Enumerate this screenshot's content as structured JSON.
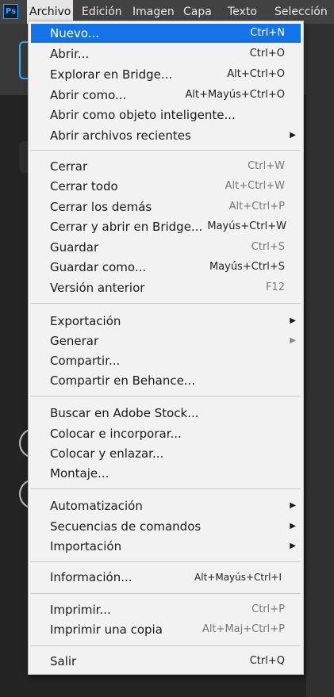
{
  "app": {
    "logo_text": "Ps"
  },
  "menubar": {
    "items": [
      "Archivo",
      "Edición",
      "Imagen",
      "Capa",
      "Texto",
      "Selección"
    ]
  },
  "file_menu": {
    "items": [
      {
        "label": "Nuevo...",
        "shortcut": "Ctrl+N",
        "highlighted": true
      },
      {
        "label": "Abrir...",
        "shortcut": "Ctrl+O"
      },
      {
        "label": "Explorar en Bridge...",
        "shortcut": "Alt+Ctrl+O"
      },
      {
        "label": "Abrir como...",
        "shortcut": "Alt+Mayús+Ctrl+O"
      },
      {
        "label": "Abrir como objeto inteligente..."
      },
      {
        "label": "Abrir archivos recientes",
        "submenu": true
      },
      {
        "label": "Cerrar",
        "shortcut": "Ctrl+W"
      },
      {
        "label": "Cerrar todo",
        "shortcut": "Alt+Ctrl+W"
      },
      {
        "label": "Cerrar los demás",
        "shortcut": "Alt+Ctrl+P"
      },
      {
        "label": "Cerrar y abrir en Bridge...",
        "shortcut": "Mayús+Ctrl+W"
      },
      {
        "label": "Guardar",
        "shortcut": "Ctrl+S"
      },
      {
        "label": "Guardar como...",
        "shortcut": "Mayús+Ctrl+S"
      },
      {
        "label": "Versión anterior",
        "shortcut": "F12"
      },
      {
        "label": "Exportación",
        "submenu": true
      },
      {
        "label": "Generar",
        "submenu": true
      },
      {
        "label": "Compartir..."
      },
      {
        "label": "Compartir en Behance..."
      },
      {
        "label": "Buscar en Adobe Stock..."
      },
      {
        "label": "Colocar e incorporar..."
      },
      {
        "label": "Colocar y enlazar..."
      },
      {
        "label": "Montaje..."
      },
      {
        "label": "Automatización",
        "submenu": true
      },
      {
        "label": "Secuencias de comandos",
        "submenu": true
      },
      {
        "label": "Importación",
        "submenu": true
      },
      {
        "label": "Información...",
        "shortcut": "Alt+Mayús+Ctrl+I"
      },
      {
        "label": "Imprimir...",
        "shortcut": "Ctrl+P"
      },
      {
        "label": "Imprimir una copia",
        "shortcut": "Alt+Maj+Ctrl+P"
      },
      {
        "label": "Salir",
        "shortcut": "Ctrl+Q"
      }
    ]
  }
}
